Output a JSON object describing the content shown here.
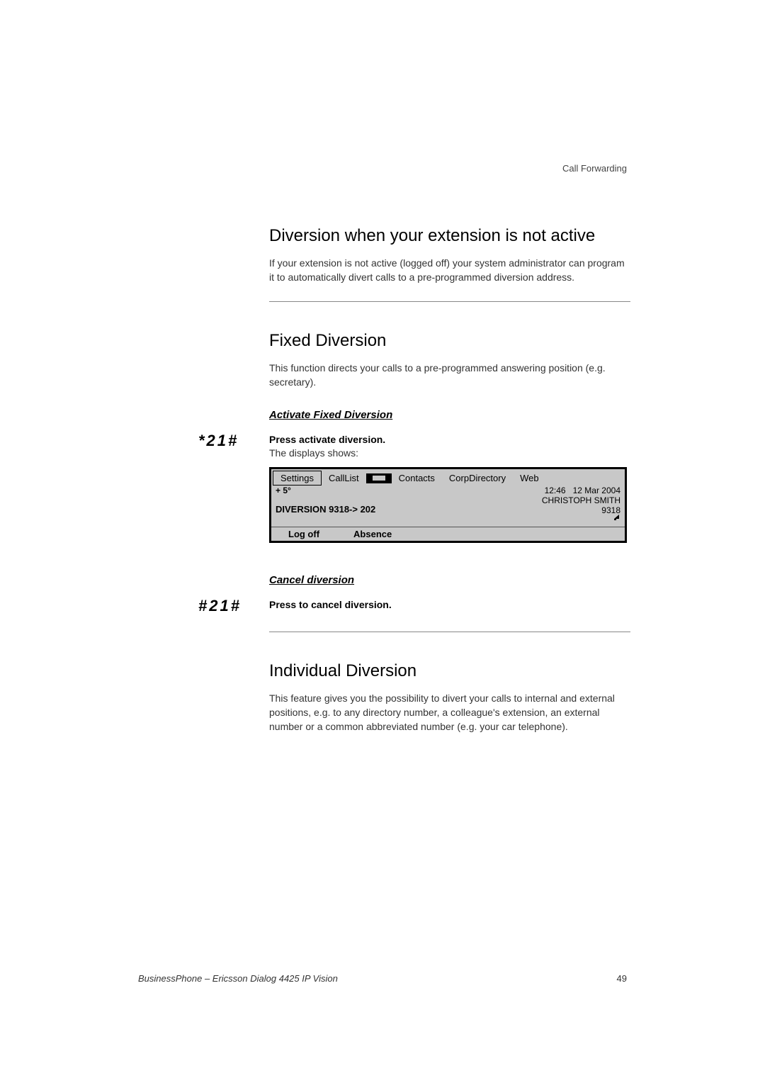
{
  "header": "Call Forwarding",
  "section1": {
    "title": "Diversion when your extension is not active",
    "body": "If your extension is not active (logged off) your system administrator can program it to automatically divert calls to a pre-programmed diversion address."
  },
  "section2": {
    "title": "Fixed Diversion",
    "body": "This function directs your calls to a pre-programmed answering position (e.g. secretary).",
    "sub1": {
      "heading": "Activate Fixed Diversion",
      "code": "*21#",
      "action": "Press activate diversion.",
      "subtext": "The displays shows:"
    },
    "sub2": {
      "heading": "Cancel diversion",
      "code": "#21#",
      "action": "Press to cancel diversion."
    }
  },
  "display": {
    "menu": [
      "Settings",
      "CallList",
      "Contacts",
      "CorpDirectory",
      "Web"
    ],
    "temp": "+ 5°",
    "time": "12:46",
    "date": "12 Mar 2004",
    "name": "CHRISTOPH SMITH",
    "ext": "9318",
    "diversion": "DIVERSION 9318-> 202",
    "bottom": [
      "Log off",
      "Absence"
    ]
  },
  "section3": {
    "title": "Individual Diversion",
    "body": "This feature gives you the possibility to divert your calls to internal and external positions, e.g. to any directory number, a colleague's extension, an external number or a common abbreviated number (e.g. your car telephone)."
  },
  "footer": {
    "text": "BusinessPhone – Ericsson Dialog 4425 IP Vision",
    "page": "49"
  }
}
